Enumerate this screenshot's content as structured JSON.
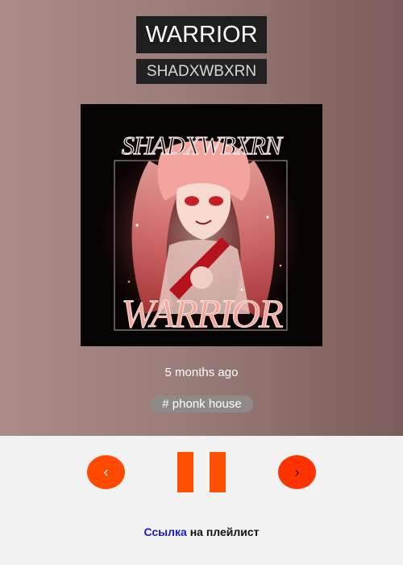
{
  "track": {
    "title": "WARRIOR",
    "artist": "SHADXWBXRN",
    "posted": "5 months ago",
    "tag": "# phonk house"
  },
  "cover": {
    "top_text": "SHADXWBXRN",
    "bottom_text": "WARRIOR"
  },
  "controls": {
    "prev_label": "‹",
    "next_label": "›",
    "pause_icon": "pause-icon"
  },
  "footer": {
    "link_text": "Ссылка",
    "suffix_text": "на плейлист"
  },
  "colors": {
    "accent": "#ff4a00",
    "link": "#1a1acc"
  }
}
